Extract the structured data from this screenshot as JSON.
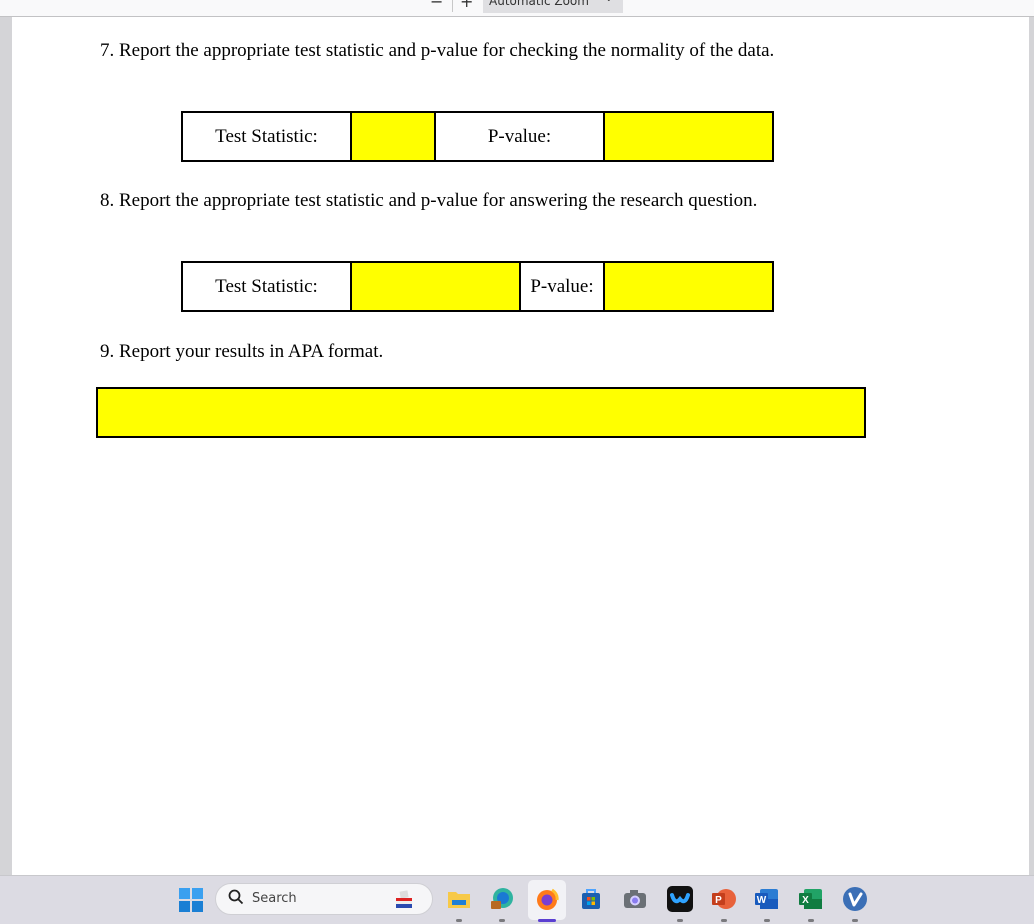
{
  "toolbar": {
    "zoom_out_icon": "minus-icon",
    "zoom_in_icon": "plus-icon",
    "zoom_select_value": "Automatic Zoom",
    "zoom_select_chevron": "⌄",
    "minus_glyph": "−",
    "plus_glyph": "+"
  },
  "document": {
    "question7": {
      "text": "7. Report the appropriate test statistic and p-value for checking the normality of the data.",
      "table": {
        "test_statistic_label": "Test Statistic:",
        "test_statistic_value": "",
        "p_value_label": "P-value:",
        "p_value_value": ""
      }
    },
    "question8": {
      "text": "8. Report the appropriate test statistic and p-value for answering the research question.",
      "table": {
        "test_statistic_label": "Test Statistic:",
        "test_statistic_value": "",
        "p_value_label": "P-value:",
        "p_value_value": ""
      }
    },
    "question9": {
      "text": "9. Report your results in APA format.",
      "answer": ""
    },
    "highlight_color": "#ffff00"
  },
  "taskbar": {
    "search_placeholder": "Search",
    "search_icon_glyph": "⚲",
    "apps": [
      {
        "name": "File Explorer",
        "icon": "folder-icon"
      },
      {
        "name": "Microsoft Edge",
        "icon": "edge-icon"
      },
      {
        "name": "Firefox",
        "icon": "firefox-icon",
        "active": true
      },
      {
        "name": "Microsoft Store",
        "icon": "store-icon"
      },
      {
        "name": "Camera",
        "icon": "camera-icon"
      },
      {
        "name": "Webex",
        "icon": "webex-icon"
      },
      {
        "name": "PowerPoint",
        "icon": "powerpoint-icon",
        "letter": "P"
      },
      {
        "name": "Word",
        "icon": "word-icon",
        "letter": "W"
      },
      {
        "name": "Excel",
        "icon": "excel-icon",
        "letter": "X"
      },
      {
        "name": "Vimeo",
        "icon": "vimeo-icon",
        "letter": "V"
      }
    ]
  }
}
